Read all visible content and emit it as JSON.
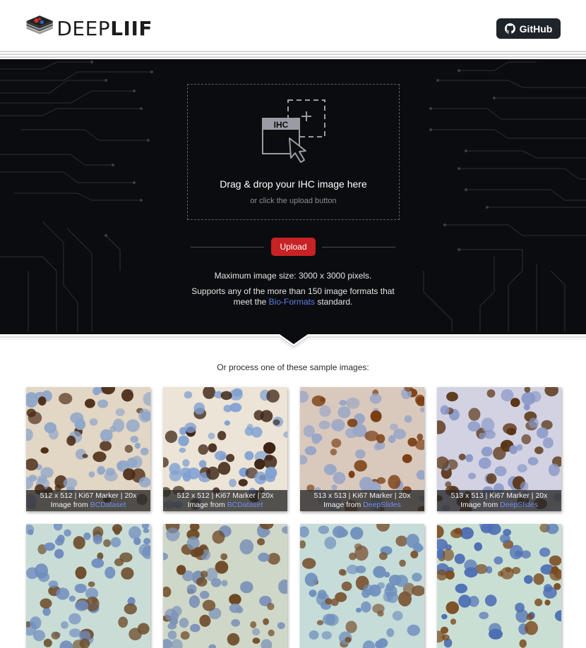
{
  "header": {
    "logo_prefix": "DEEP",
    "logo_suffix": "LIIF",
    "github_label": "GitHub"
  },
  "hero": {
    "icon_label": "IHC",
    "drop_title": "Drag & drop your IHC image here",
    "drop_subtitle": "or click the upload button",
    "upload_label": "Upload",
    "max_size": "Maximum image size: 3000 x 3000 pixels.",
    "formats_before": "Supports any of the more than 150 image formats that meet the ",
    "formats_link": "Bio-Formats",
    "formats_after": " standard."
  },
  "samples": {
    "title": "Or process one of these sample images:",
    "image_from_label": "Image from ",
    "items": [
      {
        "size": "512 x 512",
        "marker": "Ki67 Marker",
        "zoom": "20x",
        "source": "BCDataset",
        "bg": "#e2d6c4",
        "nucleus": "#4a2a14",
        "blue": "#8fa6c9"
      },
      {
        "size": "512 x 512",
        "marker": "Ki67 Marker",
        "zoom": "20x",
        "source": "BCDataset",
        "bg": "#ece4d6",
        "nucleus": "#3d2414",
        "blue": "#7fa0d2"
      },
      {
        "size": "513 x 513",
        "marker": "Ki67 Marker",
        "zoom": "20x",
        "source": "DeepSlides",
        "bg": "#d9c9bd",
        "nucleus": "#7a3e12",
        "blue": "#9aa6c6"
      },
      {
        "size": "513 x 513",
        "marker": "Ki67 Marker",
        "zoom": "20x",
        "source": "DeepSlides",
        "bg": "#d2d2e2",
        "nucleus": "#5a3414",
        "blue": "#8a98c8"
      },
      {
        "bg": "#c9ddd6",
        "nucleus": "#6e4e2c",
        "blue": "#6f8bbe"
      },
      {
        "bg": "#cfd8c8",
        "nucleus": "#6a4420",
        "blue": "#7d93b8"
      },
      {
        "bg": "#c6dcd8",
        "nucleus": "#7a5534",
        "blue": "#6f8fbd"
      },
      {
        "bg": "#cadfd4",
        "nucleus": "#7a4a1e",
        "blue": "#4d6fb4"
      }
    ]
  }
}
